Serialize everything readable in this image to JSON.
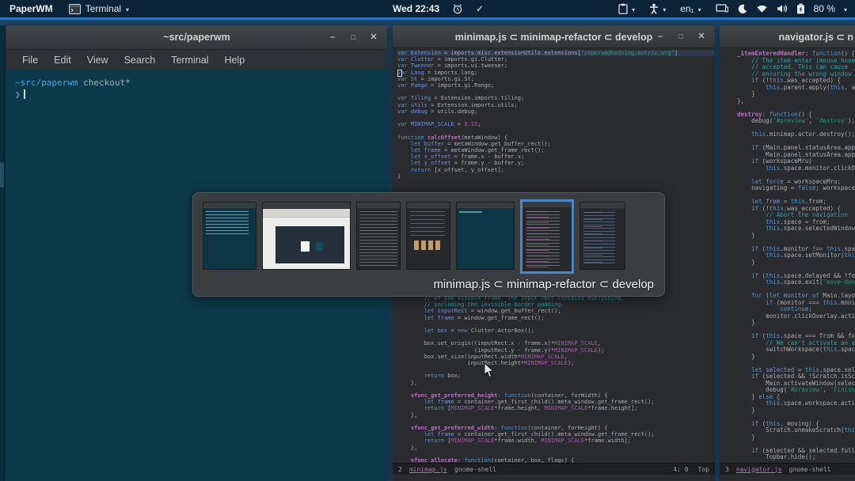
{
  "topbar": {
    "wm_label": "PaperWM",
    "app_name": "Terminal",
    "clock": "Wed 22:43",
    "check_label": "✓",
    "keyboard_layout": "en₁",
    "battery_percent": "80 %",
    "chevron": "▾"
  },
  "terminal_window": {
    "title": "~src/paperwm",
    "controls": {
      "minimize": "–",
      "maximize": "□",
      "close": "✕"
    },
    "menus": [
      "File",
      "Edit",
      "View",
      "Search",
      "Terminal",
      "Help"
    ],
    "git_line": {
      "path": "~src/paperwm",
      "status": "checkout*"
    },
    "prompt": "❯"
  },
  "editor_window": {
    "title": "minimap.js ⊂ minimap-refactor ⊂ develop",
    "controls": {
      "minimize": "–",
      "maximize": "□",
      "close": "✕"
    },
    "highlight_line": 0,
    "code_top": [
      "var Extension = imports.misc.extensionUtils.extensions[\"paperwm@hedning:matrix.org\"]",
      "var Clutter = imports.gi.Clutter;",
      "var Tweener = imports.ui.tweener;",
      "var Lang = imports.lang;",
      "var St = imports.gi.St;",
      "var Pango = imports.gi.Pango;",
      "",
      "var Tiling = Extension.imports.tiling;",
      "var utils = Extension.imports.utils;",
      "var debug = utils.debug;",
      "",
      "var MINIMAP_SCALE = 0.15;",
      "",
      "function calcOffset(metaWindow) {",
      "    let buffer = metaWindow.get_buffer_rect();",
      "    let frame = metaWindow.get_frame_rect();",
      "    let x_offset = frame.x - buffer.x;",
      "    let y_offset = frame.y - buffer.y;",
      "    return [x_offset, y_offset];",
      "}"
    ],
    "code_bottom": [
      "        // of the visible frame. The input rect contains everything,",
      "        // including the invisible border padding.",
      "        let inputRect = window.get_buffer_rect();",
      "        let frame = window.get_frame_rect();",
      "",
      "        let box = new Clutter.ActorBox();",
      "",
      "        box.set_origin((inputRect.x - frame.x)*MINIMAP_SCALE,",
      "                       (inputRect.y - frame.y)*MINIMAP_SCALE);",
      "        box.set_size(inputRect.width*MINIMAP_SCALE,",
      "                     inputRect.height*MINIMAP_SCALE);",
      "",
      "        return box;",
      "    },",
      "",
      "    vfunc_get_preferred_height: function(container, forWidth) {",
      "        let frame = container.get_first_child().meta_window.get_frame_rect();",
      "        return [MINIMAP_SCALE*frame.height, MINIMAP_SCALE*frame.height];",
      "    },",
      "",
      "    vfunc_get_preferred_width: function(container, forHeight) {",
      "        let frame = container.get_first_child().meta_window.get_frame_rect();",
      "        return [MINIMAP_SCALE*frame.width, MINIMAP_SCALE*frame.width];",
      "    },",
      "",
      "    vfunc_allocate: function(container, box, flags) {"
    ],
    "modeline": {
      "window_number": "2",
      "buffer": "minimap.js",
      "mode": "gnome-shell",
      "position": "4: 0",
      "scroll": "Top"
    }
  },
  "navigator_window": {
    "title": "navigator.js ⊂ n",
    "code": [
      "    _itemEnteredHandler: function() {",
      "        // The item-enter (mouse hover) event",
      "        // accepted. This can cause _select t",
      "        // ensuring the wrong window",
      "        if (!this.was_accepted) {",
      "            this.parent.apply(this, arguments)",
      "        }",
      "    },",
      "",
      "    destroy: function() {",
      "        debug('#preview', 'destroy');",
      "",
      "        this.minimap.actor.destroy();",
      "",
      "        if (Main.panel.statusArea.appMenu)",
      "            Main.panel.statusArea.appMenu.con",
      "        if (workspaceMru)",
      "            this.space.monitor.clickOverlay.r",
      "",
      "        let force = workspaceMru;",
      "        navigating = false; workspaceMru = fa",
      "",
      "        let from = this.from;",
      "        if (!this.was_accepted) {",
      "            // Abort the navigation",
      "            this.space = from;",
      "            this.space.selectedWindow = from.",
      "        }",
      "",
      "        if (this.monitor !== this.space.monit",
      "            this.space.setMonitor(this.monito",
      "        }",
      "",
      "        if (this.space.delayed && !force)",
      "            this.space.exit('move-done');",
      "",
      "        for (let monitor of Main.layoutManage",
      "            if (monitor === this.monitor)",
      "                continue;",
      "            monitor.clickOverlay.activate();",
      "        }",
      "",
      "        if (this.space === from && force) {",
      "            // We can't activate an already a",
      "            switchWorkspace(this.space.worksp",
      "        }",
      "",
      "        let selected = this.space.selectedWin",
      "        if (selected && !Scratch.isScratchWin",
      "            Main.activateWindow(selected);",
      "            debug('#preview', 'Finish', selec",
      "        } else {",
      "            this.space.workspace.activate(glo",
      "        }",
      "",
      "        if (this._moving) {",
      "            Scratch.unmakeScratch(this._movin",
      "        }",
      "",
      "        if (selected && selected.fullscreen)",
      "            Topbar.hide();"
    ],
    "modeline": {
      "window_number": "3",
      "buffer": "navigator.js",
      "mode": "gnome-shell"
    }
  },
  "switcher": {
    "label": "minimap.js ⊂ minimap-refactor ⊂ develop",
    "thumbnails": [
      {
        "kind": "terminal",
        "selected": false
      },
      {
        "kind": "browser",
        "selected": false
      },
      {
        "kind": "files",
        "selected": false
      },
      {
        "kind": "doc",
        "selected": false
      },
      {
        "kind": "terminal-empty",
        "selected": false
      },
      {
        "kind": "editor-focus",
        "selected": true
      },
      {
        "kind": "editor",
        "selected": false
      }
    ]
  },
  "colors": {
    "accent": "#2e76c2",
    "terminal_bg": "#0d3a4b",
    "editor_bg": "#292b2e",
    "selection": "#4e86c3"
  }
}
